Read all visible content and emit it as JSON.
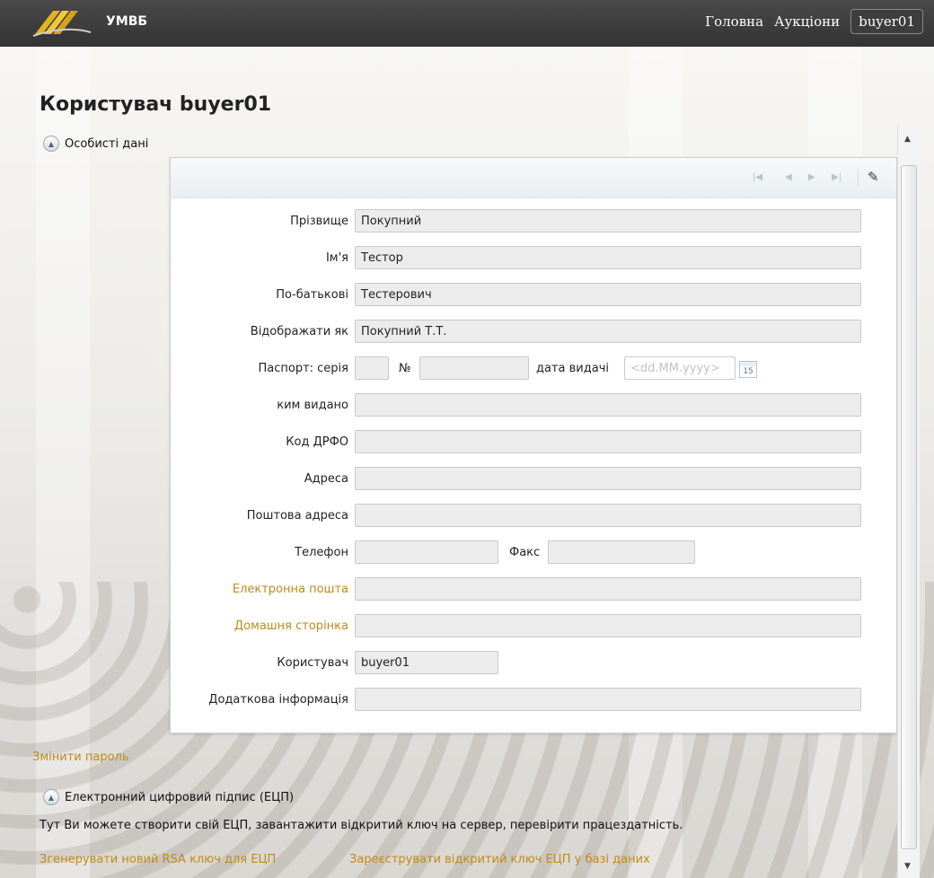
{
  "header": {
    "brand": "УМВБ",
    "nav": [
      "Головна",
      "Аукціони"
    ],
    "user_button": "buyer01"
  },
  "page": {
    "title": "Користувач buyer01"
  },
  "personal_section": {
    "title": "Особисті дані",
    "fields": {
      "surname": {
        "label": "Прізвище",
        "value": "Покупний"
      },
      "name": {
        "label": "Ім'я",
        "value": "Тестор"
      },
      "patronymic": {
        "label": "По-батькові",
        "value": "Тестерович"
      },
      "display_as": {
        "label": "Відображати як",
        "value": "Покупний Т.Т."
      },
      "passport": {
        "label": "Паспорт: серія",
        "number_label": "№",
        "date_label": "дата видачі",
        "date_placeholder": "<dd.MM.yyyy>",
        "calendar_day": "15"
      },
      "issued_by": {
        "label": "ким видано",
        "value": ""
      },
      "tax_code": {
        "label": "Код ДРФО",
        "value": ""
      },
      "address": {
        "label": "Адреса",
        "value": ""
      },
      "postal_address": {
        "label": "Поштова адреса",
        "value": ""
      },
      "phone": {
        "label": "Телефон",
        "value": ""
      },
      "fax": {
        "label": "Факс",
        "value": ""
      },
      "email": {
        "label": "Електронна пошта",
        "value": ""
      },
      "homepage": {
        "label": "Домашня сторінка",
        "value": ""
      },
      "user": {
        "label": "Користувач",
        "value": "buyer01"
      },
      "additional_info": {
        "label": "Додаткова інформація",
        "value": ""
      }
    }
  },
  "change_password": "Змінити пароль",
  "ecp_section": {
    "title": "Електронний цифровий підпис (ЕЦП)",
    "description": "Тут Ви можете створити свій ЕЦП, завантажити відкритий ключ на сервер, перевірити працездатність.",
    "generate_link": "Згенерувати новий RSA ключ для ЕЦП",
    "register_link": "Зареєструвати відкритий ключ ЕЦП у базі даних"
  }
}
